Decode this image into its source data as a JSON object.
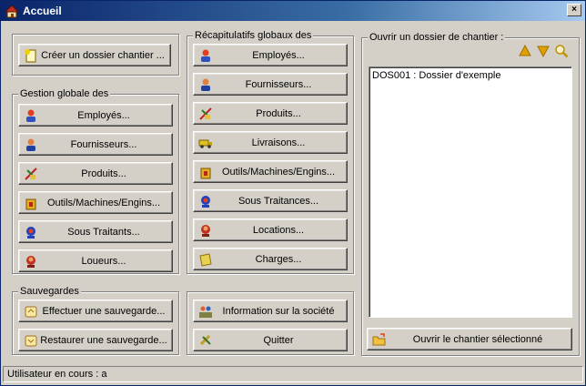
{
  "window": {
    "title": "Accueil"
  },
  "create": {
    "label": "Créer un dossier chantier ..."
  },
  "gestion": {
    "title": "Gestion globale des",
    "items": [
      "Employés...",
      "Fournisseurs...",
      "Produits...",
      "Outils/Machines/Engins...",
      "Sous Traitants...",
      "Loueurs..."
    ]
  },
  "recap": {
    "title": "Récapitulatifs globaux des",
    "items": [
      "Employés...",
      "Fournisseurs...",
      "Produits...",
      "Livraisons...",
      "Outils/Machines/Engins...",
      "Sous Traitances...",
      "Locations...",
      "Charges..."
    ]
  },
  "sauvegardes": {
    "title": "Sauvegardes",
    "backup": "Effectuer une sauvegarde...",
    "restore": "Restaurer une sauvegarde..."
  },
  "misc": {
    "info": "Information sur la société",
    "quit": "Quitter"
  },
  "ouvrir": {
    "title": "Ouvrir un dossier de chantier :",
    "list": [
      "DOS001 : Dossier d'exemple"
    ],
    "open_button": "Ouvrir le chantier sélectionné"
  },
  "status": {
    "text": "Utilisateur en cours : a"
  },
  "colors": {
    "titlebar": "#0a246a",
    "face": "#d4d0c8",
    "arrow": "#e0a000"
  }
}
